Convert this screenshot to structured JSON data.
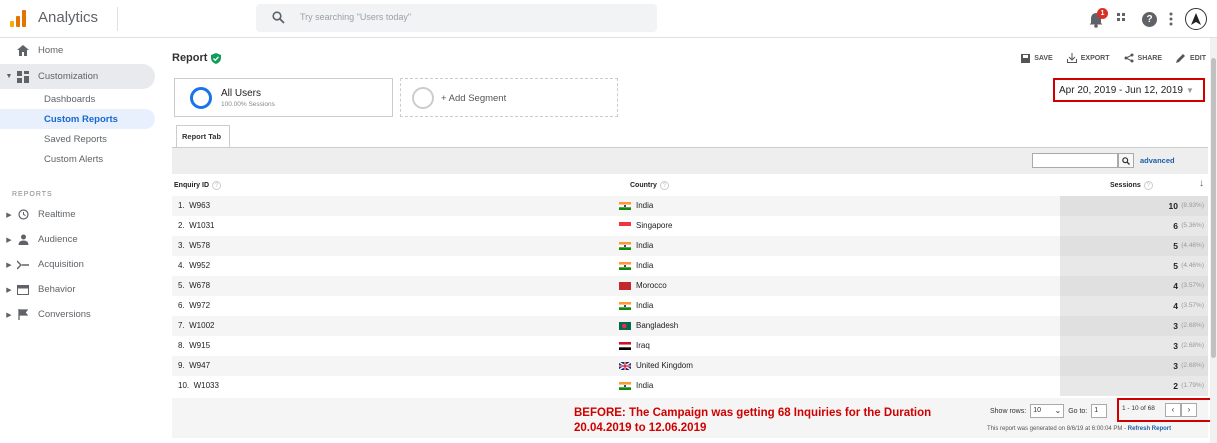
{
  "app": {
    "brand": "Analytics",
    "search_placeholder": "Try searching \"Users today\"",
    "notification_count": "1"
  },
  "sidebar": {
    "home": "Home",
    "customization": "Customization",
    "sub_items": [
      "Dashboards",
      "Custom Reports",
      "Saved Reports",
      "Custom Alerts"
    ],
    "reports_label": "REPORTS",
    "reports": [
      "Realtime",
      "Audience",
      "Acquisition",
      "Behavior",
      "Conversions"
    ]
  },
  "report": {
    "title": "Report",
    "actions": [
      "SAVE",
      "EXPORT",
      "SHARE",
      "EDIT"
    ],
    "segment_name": "All Users",
    "segment_sub": "100.00% Sessions",
    "add_segment": "+ Add Segment",
    "date_range": "Apr 20, 2019 - Jun 12, 2019",
    "tab": "Report Tab",
    "advanced": "advanced"
  },
  "table": {
    "headers": {
      "enquiry": "Enquiry ID",
      "country": "Country",
      "sessions": "Sessions"
    },
    "rows": [
      {
        "idx": "1.",
        "id": "W963",
        "country": "India",
        "sessions": "10",
        "pct": "(8.93%)"
      },
      {
        "idx": "2.",
        "id": "W1031",
        "country": "Singapore",
        "sessions": "6",
        "pct": "(5.36%)"
      },
      {
        "idx": "3.",
        "id": "W578",
        "country": "India",
        "sessions": "5",
        "pct": "(4.46%)"
      },
      {
        "idx": "4.",
        "id": "W952",
        "country": "India",
        "sessions": "5",
        "pct": "(4.46%)"
      },
      {
        "idx": "5.",
        "id": "W678",
        "country": "Morocco",
        "sessions": "4",
        "pct": "(3.57%)"
      },
      {
        "idx": "6.",
        "id": "W972",
        "country": "India",
        "sessions": "4",
        "pct": "(3.57%)"
      },
      {
        "idx": "7.",
        "id": "W1002",
        "country": "Bangladesh",
        "sessions": "3",
        "pct": "(2.68%)"
      },
      {
        "idx": "8.",
        "id": "W915",
        "country": "Iraq",
        "sessions": "3",
        "pct": "(2.68%)"
      },
      {
        "idx": "9.",
        "id": "W947",
        "country": "United Kingdom",
        "sessions": "3",
        "pct": "(2.68%)"
      },
      {
        "idx": "10.",
        "id": "W1033",
        "country": "India",
        "sessions": "2",
        "pct": "(1.79%)"
      }
    ]
  },
  "footer": {
    "annotation_line1": "BEFORE: The Campaign was getting 68 Inquiries for the Duration",
    "annotation_line2": "20.04.2019 to 12.06.2019",
    "show_rows_label": "Show rows:",
    "show_rows_value": "10",
    "goto_label": "Go to:",
    "goto_value": "1",
    "range": "1 - 10 of 68",
    "generated": "This report was generated on 8/6/19 at 6:00:04 PM -",
    "refresh": "Refresh Report"
  },
  "colors": {
    "accent": "#1a73e8",
    "highlight": "#d00000"
  }
}
